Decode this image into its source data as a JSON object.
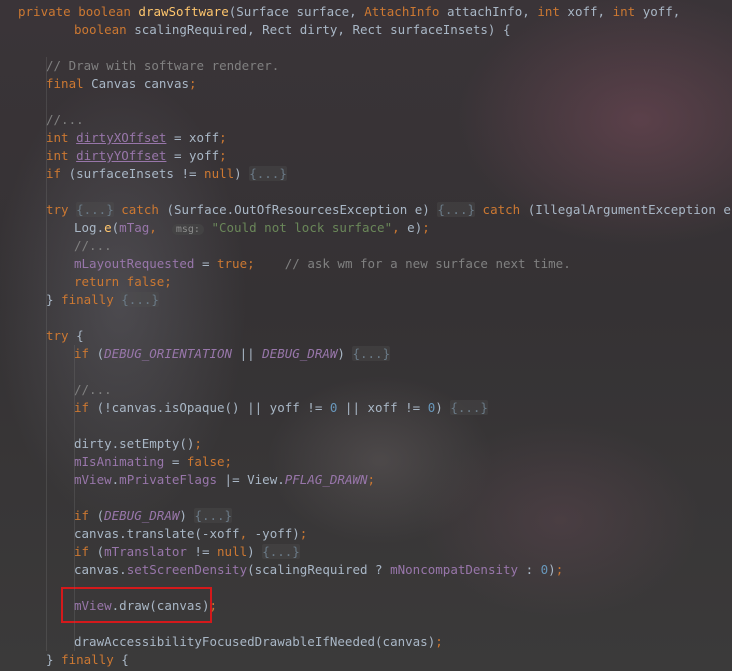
{
  "colors": {
    "keyword": "#cc7832",
    "method_declaration": "#ffc66d",
    "identifier": "#a9b7c6",
    "comment": "#808080",
    "string": "#6a8759",
    "number": "#6897bb",
    "field": "#9876aa",
    "highlight_border": "#d4191b"
  },
  "code_lines": [
    {
      "indent": 0,
      "tokens": [
        {
          "t": "private boolean ",
          "s": "kw"
        },
        {
          "t": "drawSoftware",
          "s": "fn"
        },
        {
          "t": "(Surface surface, ",
          "s": "id"
        },
        {
          "t": "AttachInfo ",
          "s": "kw"
        },
        {
          "t": "attachInfo, ",
          "s": "id"
        },
        {
          "t": "int ",
          "s": "kw"
        },
        {
          "t": "xoff, ",
          "s": "id"
        },
        {
          "t": "int ",
          "s": "kw"
        },
        {
          "t": "yoff,",
          "s": "id"
        }
      ]
    },
    {
      "indent": 2,
      "tokens": [
        {
          "t": "boolean ",
          "s": "kw"
        },
        {
          "t": "scalingRequired, Rect dirty, Rect surfaceInsets) {",
          "s": "id"
        }
      ]
    },
    {
      "indent": 0,
      "tokens": []
    },
    {
      "indent": 1,
      "tokens": [
        {
          "t": "// Draw with software renderer.",
          "s": "cm"
        }
      ]
    },
    {
      "indent": 1,
      "tokens": [
        {
          "t": "final ",
          "s": "kw"
        },
        {
          "t": "Canvas canvas",
          "s": "id"
        },
        {
          "t": ";",
          "s": "kw"
        }
      ]
    },
    {
      "indent": 0,
      "tokens": []
    },
    {
      "indent": 1,
      "tokens": [
        {
          "t": "//...",
          "s": "cm"
        }
      ]
    },
    {
      "indent": 1,
      "tokens": [
        {
          "t": "int ",
          "s": "kw"
        },
        {
          "t": "dirtyXOffset",
          "s": "ul"
        },
        {
          "t": " = xoff",
          "s": "id"
        },
        {
          "t": ";",
          "s": "kw"
        }
      ]
    },
    {
      "indent": 1,
      "tokens": [
        {
          "t": "int ",
          "s": "kw"
        },
        {
          "t": "dirtyYOffset",
          "s": "ul"
        },
        {
          "t": " = yoff",
          "s": "id"
        },
        {
          "t": ";",
          "s": "kw"
        }
      ]
    },
    {
      "indent": 1,
      "tokens": [
        {
          "t": "if ",
          "s": "kw"
        },
        {
          "t": "(surfaceInsets != ",
          "s": "id"
        },
        {
          "t": "null",
          "s": "kw"
        },
        {
          "t": ") ",
          "s": "id"
        },
        {
          "t": "{...}",
          "s": "fo"
        }
      ]
    },
    {
      "indent": 0,
      "tokens": []
    },
    {
      "indent": 1,
      "tokens": [
        {
          "t": "try ",
          "s": "kw"
        },
        {
          "t": "{...}",
          "s": "fo"
        },
        {
          "t": " ",
          "s": "id"
        },
        {
          "t": "catch ",
          "s": "kw"
        },
        {
          "t": "(Surface.OutOfResourcesException e) ",
          "s": "id"
        },
        {
          "t": "{...}",
          "s": "fo"
        },
        {
          "t": " ",
          "s": "id"
        },
        {
          "t": "catch ",
          "s": "kw"
        },
        {
          "t": "(IllegalArgumentException e) {",
          "s": "id"
        }
      ]
    },
    {
      "indent": 2,
      "tokens": [
        {
          "t": "Log.",
          "s": "id"
        },
        {
          "t": "e",
          "s": "mc"
        },
        {
          "t": "(",
          "s": "id"
        },
        {
          "t": "mTag",
          "s": "fd"
        },
        {
          "t": ",  ",
          "s": "kw"
        },
        {
          "t": "msg:",
          "s": "hn"
        },
        {
          "t": " ",
          "s": "id"
        },
        {
          "t": "\"Could not lock surface\"",
          "s": "st"
        },
        {
          "t": ", ",
          "s": "kw"
        },
        {
          "t": "e)",
          "s": "id"
        },
        {
          "t": ";",
          "s": "kw"
        }
      ]
    },
    {
      "indent": 2,
      "tokens": [
        {
          "t": "//...",
          "s": "cm"
        }
      ]
    },
    {
      "indent": 2,
      "tokens": [
        {
          "t": "mLayoutRequested",
          "s": "fd"
        },
        {
          "t": " = ",
          "s": "id"
        },
        {
          "t": "true",
          "s": "kw"
        },
        {
          "t": ";    ",
          "s": "kw"
        },
        {
          "t": "// ask wm for a new surface next time.",
          "s": "cm"
        }
      ]
    },
    {
      "indent": 2,
      "tokens": [
        {
          "t": "return false;",
          "s": "kw"
        }
      ]
    },
    {
      "indent": 1,
      "tokens": [
        {
          "t": "} ",
          "s": "id"
        },
        {
          "t": "finally ",
          "s": "kw"
        },
        {
          "t": "{...}",
          "s": "fo"
        }
      ]
    },
    {
      "indent": 0,
      "tokens": []
    },
    {
      "indent": 1,
      "tokens": [
        {
          "t": "try ",
          "s": "kw"
        },
        {
          "t": "{",
          "s": "id"
        }
      ]
    },
    {
      "indent": 2,
      "tokens": [
        {
          "t": "if ",
          "s": "kw"
        },
        {
          "t": "(",
          "s": "id"
        },
        {
          "t": "DEBUG_ORIENTATION",
          "s": "cs"
        },
        {
          "t": " || ",
          "s": "id"
        },
        {
          "t": "DEBUG_DRAW",
          "s": "cs"
        },
        {
          "t": ") ",
          "s": "id"
        },
        {
          "t": "{...}",
          "s": "fo"
        }
      ]
    },
    {
      "indent": 0,
      "tokens": []
    },
    {
      "indent": 2,
      "tokens": [
        {
          "t": "//...",
          "s": "cm"
        }
      ]
    },
    {
      "indent": 2,
      "tokens": [
        {
          "t": "if ",
          "s": "kw"
        },
        {
          "t": "(!canvas.isOpaque() || yoff != ",
          "s": "id"
        },
        {
          "t": "0",
          "s": "nu"
        },
        {
          "t": " || xoff != ",
          "s": "id"
        },
        {
          "t": "0",
          "s": "nu"
        },
        {
          "t": ") ",
          "s": "id"
        },
        {
          "t": "{...}",
          "s": "fo"
        }
      ]
    },
    {
      "indent": 0,
      "tokens": []
    },
    {
      "indent": 2,
      "tokens": [
        {
          "t": "dirty.setEmpty()",
          "s": "id"
        },
        {
          "t": ";",
          "s": "kw"
        }
      ]
    },
    {
      "indent": 2,
      "tokens": [
        {
          "t": "mIsAnimating",
          "s": "fd"
        },
        {
          "t": " = ",
          "s": "id"
        },
        {
          "t": "false;",
          "s": "kw"
        }
      ]
    },
    {
      "indent": 2,
      "tokens": [
        {
          "t": "mView",
          "s": "fd"
        },
        {
          "t": ".",
          "s": "id"
        },
        {
          "t": "mPrivateFlags",
          "s": "fd"
        },
        {
          "t": " |= View.",
          "s": "id"
        },
        {
          "t": "PFLAG_DRAWN",
          "s": "cs"
        },
        {
          "t": ";",
          "s": "kw"
        }
      ]
    },
    {
      "indent": 0,
      "tokens": []
    },
    {
      "indent": 2,
      "tokens": [
        {
          "t": "if ",
          "s": "kw"
        },
        {
          "t": "(",
          "s": "id"
        },
        {
          "t": "DEBUG_DRAW",
          "s": "cs"
        },
        {
          "t": ") ",
          "s": "id"
        },
        {
          "t": "{...}",
          "s": "fo"
        }
      ]
    },
    {
      "indent": 2,
      "tokens": [
        {
          "t": "canvas.translate(-xoff",
          "s": "id"
        },
        {
          "t": ", ",
          "s": "kw"
        },
        {
          "t": "-yoff)",
          "s": "id"
        },
        {
          "t": ";",
          "s": "kw"
        }
      ]
    },
    {
      "indent": 2,
      "tokens": [
        {
          "t": "if ",
          "s": "kw"
        },
        {
          "t": "(",
          "s": "id"
        },
        {
          "t": "mTranslator",
          "s": "fd"
        },
        {
          "t": " != ",
          "s": "id"
        },
        {
          "t": "null",
          "s": "kw"
        },
        {
          "t": ") ",
          "s": "id"
        },
        {
          "t": "{...}",
          "s": "fo"
        }
      ]
    },
    {
      "indent": 2,
      "tokens": [
        {
          "t": "canvas.",
          "s": "id"
        },
        {
          "t": "setScreenDensity",
          "s": "fd"
        },
        {
          "t": "(scalingRequired ? ",
          "s": "id"
        },
        {
          "t": "mNoncompatDensity",
          "s": "fd"
        },
        {
          "t": " : ",
          "s": "id"
        },
        {
          "t": "0",
          "s": "nu"
        },
        {
          "t": ")",
          "s": "id"
        },
        {
          "t": ";",
          "s": "kw"
        }
      ]
    },
    {
      "indent": 0,
      "tokens": []
    },
    {
      "indent": 2,
      "tokens": [
        {
          "t": "mView",
          "s": "fd"
        },
        {
          "t": ".draw(canvas)",
          "s": "id"
        },
        {
          "t": ";",
          "s": "kw"
        }
      ]
    },
    {
      "indent": 0,
      "tokens": []
    },
    {
      "indent": 2,
      "tokens": [
        {
          "t": "drawAccessibilityFocusedDrawableIfNeeded(canvas)",
          "s": "id"
        },
        {
          "t": ";",
          "s": "kw"
        }
      ]
    },
    {
      "indent": 1,
      "tokens": [
        {
          "t": "} ",
          "s": "id"
        },
        {
          "t": "finally ",
          "s": "kw"
        },
        {
          "t": "{",
          "s": "id"
        }
      ]
    }
  ]
}
